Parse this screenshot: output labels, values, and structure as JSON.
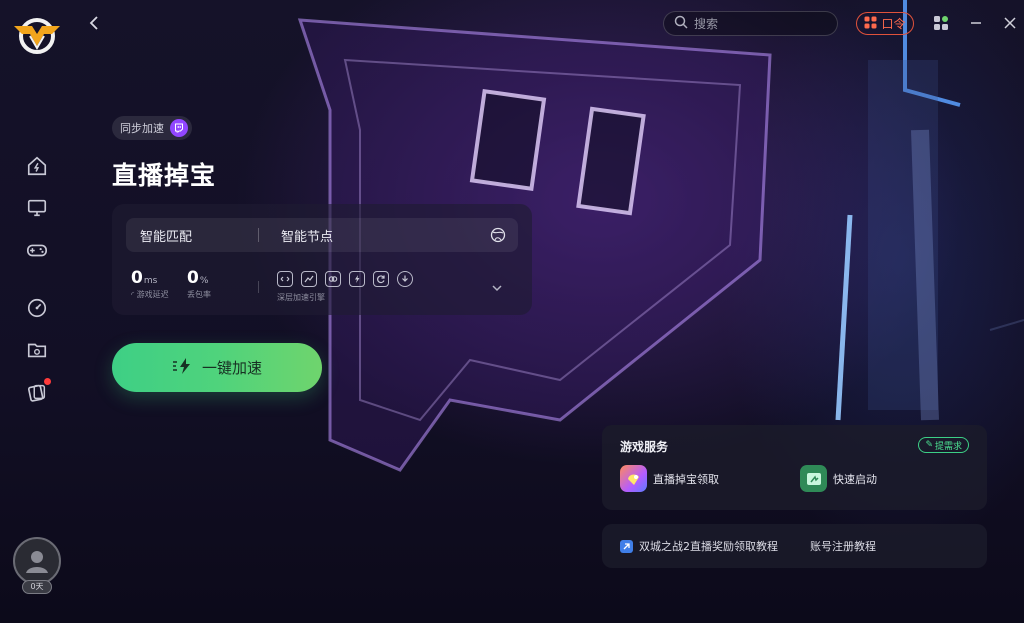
{
  "topbar": {
    "search_placeholder": "搜索",
    "koling_label": "口令"
  },
  "main": {
    "sync_tag": "同步加速",
    "title": "直播掉宝",
    "panel": {
      "match_label": "智能匹配",
      "node_label": "智能节点",
      "latency": {
        "value": "0",
        "unit": "ms",
        "label": "游戏延迟"
      },
      "packet_loss": {
        "value": "0",
        "unit": "%",
        "label": "丢包率"
      },
      "engine_label": "深层加速引擎"
    },
    "accelerate_label": "一键加速"
  },
  "services": {
    "title": "游戏服务",
    "request_label": "提需求",
    "items": [
      {
        "label": "直播掉宝领取"
      },
      {
        "label": "快速启动"
      }
    ]
  },
  "links": [
    {
      "label": "双城之战2直播奖励领取教程"
    },
    {
      "label": "账号注册教程"
    }
  ],
  "user": {
    "level_badge": "0天"
  },
  "colors": {
    "accent_green": "#3ecf85",
    "twitch_purple": "#9146ff",
    "alert_red": "#ff3b3b",
    "koling_red": "#e0523b"
  }
}
